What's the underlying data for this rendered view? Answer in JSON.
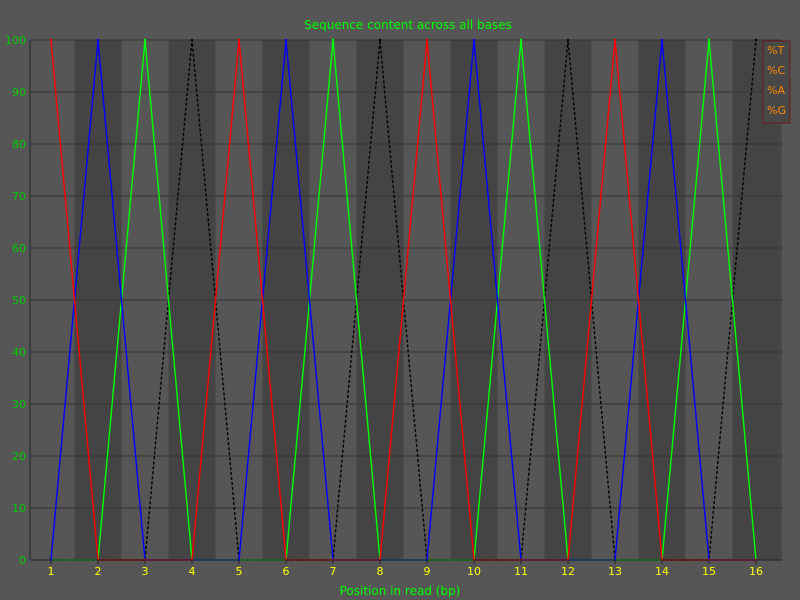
{
  "chart_data": {
    "type": "line",
    "title": "Sequence content across all bases",
    "xlabel": "Position in read (bp)",
    "ylabel": "",
    "x": [
      1,
      2,
      3,
      4,
      5,
      6,
      7,
      8,
      9,
      10,
      11,
      12,
      13,
      14,
      15,
      16
    ],
    "ylim": [
      0,
      100
    ],
    "yticks": [
      0,
      10,
      20,
      30,
      40,
      50,
      60,
      70,
      80,
      90,
      100
    ],
    "grid": true,
    "legend_position": "top-right",
    "series": [
      {
        "name": "%T",
        "color": "#ff0000",
        "values": [
          100,
          0,
          0,
          0,
          100,
          0,
          0,
          0,
          100,
          0,
          0,
          0,
          100,
          0,
          0,
          0
        ]
      },
      {
        "name": "%C",
        "color": "#0000ff",
        "values": [
          0,
          100,
          0,
          0,
          0,
          100,
          0,
          0,
          0,
          100,
          0,
          0,
          0,
          100,
          0,
          0
        ]
      },
      {
        "name": "%A",
        "color": "#00ff00",
        "values": [
          0,
          0,
          100,
          0,
          0,
          0,
          100,
          0,
          0,
          0,
          100,
          0,
          0,
          0,
          100,
          0
        ]
      },
      {
        "name": "%G",
        "color": "#000000",
        "values": [
          0,
          0,
          0,
          100,
          0,
          0,
          0,
          100,
          0,
          0,
          0,
          100,
          0,
          0,
          0,
          100
        ]
      }
    ]
  }
}
